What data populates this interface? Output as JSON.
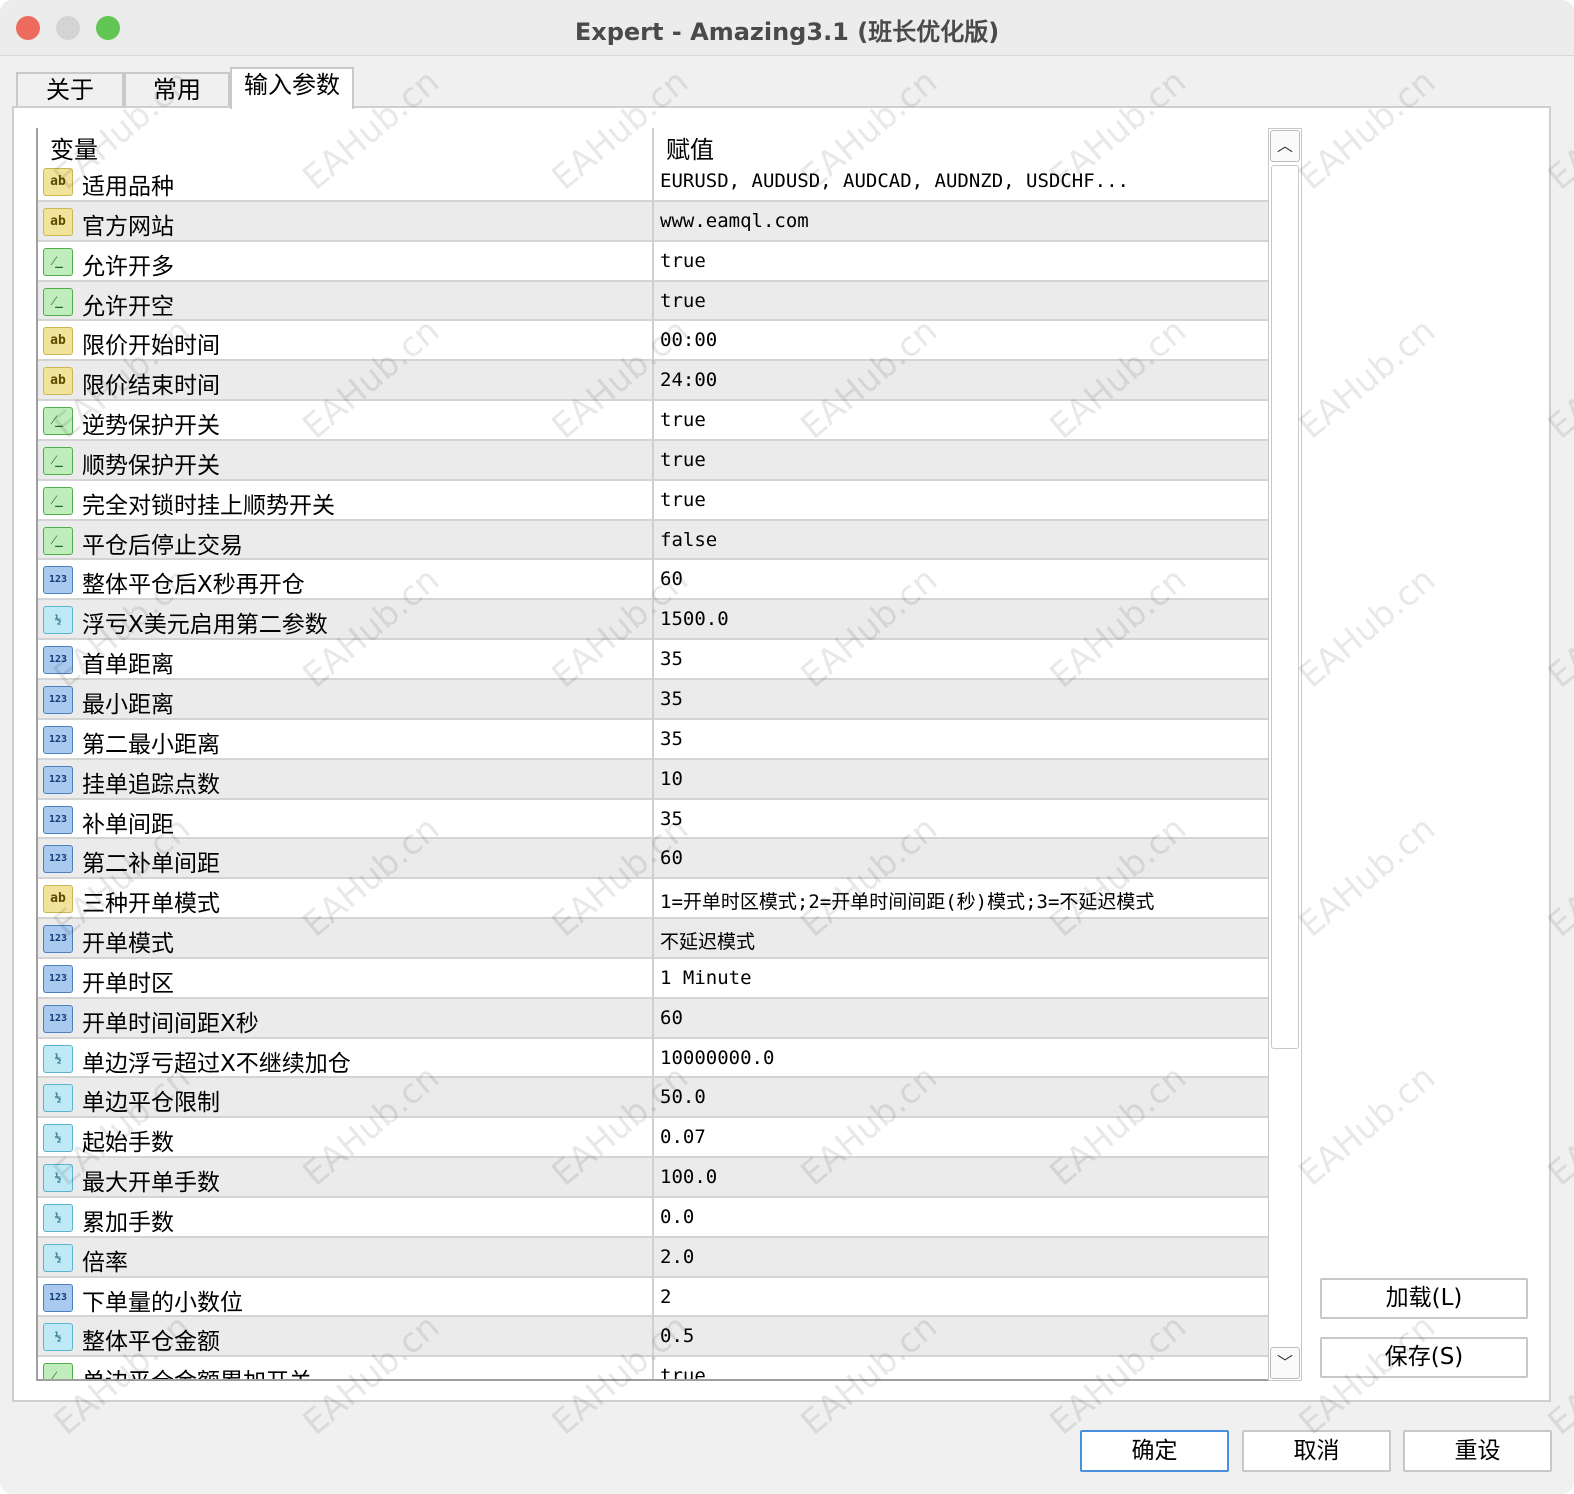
{
  "window": {
    "title": "Expert - Amazing3.1 (班长优化版)"
  },
  "tabs": [
    {
      "label": "关于"
    },
    {
      "label": "常用"
    },
    {
      "label": "输入参数"
    }
  ],
  "table": {
    "headers": {
      "variable": "变量",
      "value": "赋值"
    },
    "rows": [
      {
        "type": "ab",
        "name": "适用品种",
        "value": "EURUSD, AUDUSD, AUDCAD, AUDNZD, USDCHF..."
      },
      {
        "type": "ab",
        "name": "官方网站",
        "value": "www.eamql.com"
      },
      {
        "type": "bool",
        "name": "允许开多",
        "value": "true"
      },
      {
        "type": "bool",
        "name": "允许开空",
        "value": "true"
      },
      {
        "type": "ab",
        "name": "限价开始时间",
        "value": "00:00"
      },
      {
        "type": "ab",
        "name": "限价结束时间",
        "value": "24:00"
      },
      {
        "type": "bool",
        "name": "逆势保护开关",
        "value": "true"
      },
      {
        "type": "bool",
        "name": "顺势保护开关",
        "value": "true"
      },
      {
        "type": "bool",
        "name": "完全对锁时挂上顺势开关",
        "value": "true"
      },
      {
        "type": "bool",
        "name": "平仓后停止交易",
        "value": "false"
      },
      {
        "type": "int",
        "name": "整体平仓后X秒再开仓",
        "value": "60"
      },
      {
        "type": "dbl",
        "name": "浮亏X美元启用第二参数",
        "value": "1500.0"
      },
      {
        "type": "int",
        "name": "首单距离",
        "value": "35"
      },
      {
        "type": "int",
        "name": "最小距离",
        "value": "35"
      },
      {
        "type": "int",
        "name": "第二最小距离",
        "value": "35"
      },
      {
        "type": "int",
        "name": "挂单追踪点数",
        "value": "10"
      },
      {
        "type": "int",
        "name": "补单间距",
        "value": "35"
      },
      {
        "type": "int",
        "name": "第二补单间距",
        "value": "60"
      },
      {
        "type": "ab",
        "name": "三种开单模式",
        "value": "1=开单时区模式;2=开单时间间距(秒)模式;3=不延迟模式"
      },
      {
        "type": "int",
        "name": "开单模式",
        "value": "不延迟模式"
      },
      {
        "type": "int",
        "name": "开单时区",
        "value": "1 Minute"
      },
      {
        "type": "int",
        "name": "开单时间间距X秒",
        "value": "60"
      },
      {
        "type": "dbl",
        "name": "单边浮亏超过X不继续加仓",
        "value": "10000000.0"
      },
      {
        "type": "dbl",
        "name": "单边平仓限制",
        "value": "50.0"
      },
      {
        "type": "dbl",
        "name": "起始手数",
        "value": "0.07"
      },
      {
        "type": "dbl",
        "name": "最大开单手数",
        "value": "100.0"
      },
      {
        "type": "dbl",
        "name": "累加手数",
        "value": "0.0"
      },
      {
        "type": "dbl",
        "name": "倍率",
        "value": "2.0"
      },
      {
        "type": "int",
        "name": "下单量的小数位",
        "value": "2"
      },
      {
        "type": "dbl",
        "name": "整体平仓金额",
        "value": "0.5"
      },
      {
        "type": "bool",
        "name": "单边平仓金额累加开关",
        "value": "true"
      }
    ]
  },
  "icons": {
    "ab": "ab",
    "bool": "⁄_",
    "int": "123",
    "dbl": "½"
  },
  "side_buttons": {
    "load": "加载(L)",
    "save": "保存(S)"
  },
  "footer": {
    "ok": "确定",
    "cancel": "取消",
    "reset": "重设"
  },
  "watermark": "EAHub.cn"
}
